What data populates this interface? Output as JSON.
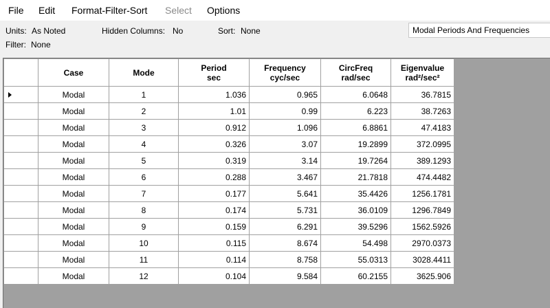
{
  "menu": {
    "file": "File",
    "edit": "Edit",
    "format_filter_sort": "Format-Filter-Sort",
    "select": "Select",
    "options": "Options"
  },
  "info": {
    "units_label": "Units:",
    "units_value": "As Noted",
    "hidden_label": "Hidden Columns:",
    "hidden_value": "No",
    "sort_label": "Sort:",
    "sort_value": "None",
    "filter_label": "Filter:",
    "filter_value": "None"
  },
  "table_selector": {
    "value": "Modal Periods And Frequencies"
  },
  "grid": {
    "headers": [
      "Case",
      "Mode",
      "Period\nsec",
      "Frequency\ncyc/sec",
      "CircFreq\nrad/sec",
      "Eigenvalue\nrad²/sec²"
    ],
    "rows": [
      [
        "Modal",
        "1",
        "1.036",
        "0.965",
        "6.0648",
        "36.7815"
      ],
      [
        "Modal",
        "2",
        "1.01",
        "0.99",
        "6.223",
        "38.7263"
      ],
      [
        "Modal",
        "3",
        "0.912",
        "1.096",
        "6.8861",
        "47.4183"
      ],
      [
        "Modal",
        "4",
        "0.326",
        "3.07",
        "19.2899",
        "372.0995"
      ],
      [
        "Modal",
        "5",
        "0.319",
        "3.14",
        "19.7264",
        "389.1293"
      ],
      [
        "Modal",
        "6",
        "0.288",
        "3.467",
        "21.7818",
        "474.4482"
      ],
      [
        "Modal",
        "7",
        "0.177",
        "5.641",
        "35.4426",
        "1256.1781"
      ],
      [
        "Modal",
        "8",
        "0.174",
        "5.731",
        "36.0109",
        "1296.7849"
      ],
      [
        "Modal",
        "9",
        "0.159",
        "6.291",
        "39.5296",
        "1562.5926"
      ],
      [
        "Modal",
        "10",
        "0.115",
        "8.674",
        "54.498",
        "2970.0373"
      ],
      [
        "Modal",
        "11",
        "0.114",
        "8.758",
        "55.0313",
        "3028.4411"
      ],
      [
        "Modal",
        "12",
        "0.104",
        "9.584",
        "60.2155",
        "3625.906"
      ]
    ],
    "current_row_icon": "row-pointer-icon"
  }
}
